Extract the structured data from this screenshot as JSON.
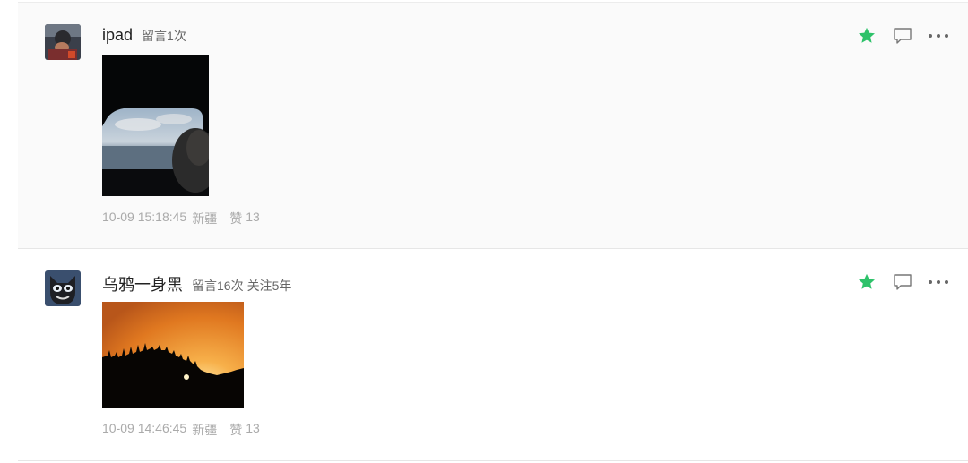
{
  "comments": [
    {
      "username": "ipad",
      "comment_count": "留言1次",
      "follow": "",
      "timestamp": "10-09 15:18:45",
      "location": "新疆",
      "like_label": "赞",
      "like_count": "13",
      "avatar": "avatar-child-photo",
      "photo": "window-ocean-photo"
    },
    {
      "username": "乌鸦一身黑",
      "comment_count": "留言16次",
      "follow": "关注5年",
      "timestamp": "10-09 14:46:45",
      "location": "新疆",
      "like_label": "赞",
      "like_count": "13",
      "avatar": "avatar-masked-face",
      "photo": "sunset-forest-photo"
    }
  ],
  "icons": {
    "star": "star-icon",
    "reply": "reply-bubble-icon",
    "more": "more-dots-icon"
  },
  "colors": {
    "star": "#2ec26a",
    "meta": "#aaaaaa",
    "username": "#222222"
  }
}
